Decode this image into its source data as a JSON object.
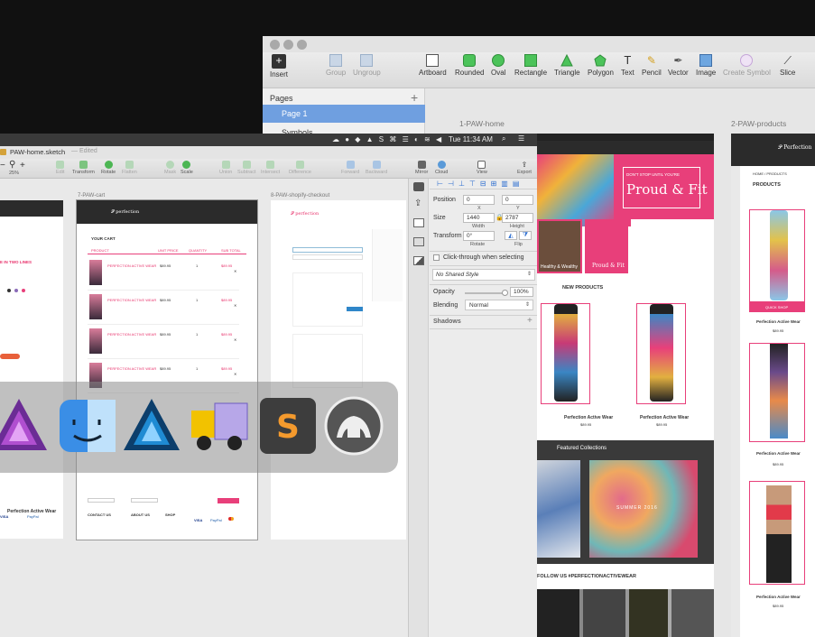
{
  "back_window": {
    "toolbar": {
      "insert": "Insert",
      "group": "Group",
      "ungroup": "Ungroup",
      "artboard": "Artboard",
      "rounded": "Rounded",
      "oval": "Oval",
      "rectangle": "Rectangle",
      "triangle": "Triangle",
      "polygon": "Polygon",
      "text": "Text",
      "pencil": "Pencil",
      "vector": "Vector",
      "image": "Image",
      "create_symbol": "Create Symbol",
      "slice": "Slice"
    },
    "pages": {
      "heading": "Pages",
      "items": [
        "Page 1",
        "Symbols"
      ]
    },
    "artboards": {
      "home_label": "1-PAW-home",
      "products_label": "2-PAW-products"
    },
    "home_artboard": {
      "hero_line1": "DON'T STOP UNTIL YOU'RE",
      "hero_title": "Proud & Fit",
      "tile_caption_1": "Healthy & Wealthy",
      "tile_caption_2": "Proud & Fit",
      "new_products": "NEW PRODUCTS",
      "product_name_1": "Perfection Active Wear",
      "product_name_2": "Perfection Active Wear",
      "product_price_1": "$89.95",
      "product_price_2": "$89.95",
      "featured": "Featured Collections",
      "summer": "SUMMER 2016",
      "follow": "FOLLOW US #PERFECTIONACTIVEWEAR"
    },
    "products_artboard": {
      "breadcrumb": "HOME / PRODUCTS",
      "heading": "PRODUCTS",
      "quick_shop": "QUICK SHOP",
      "items": [
        {
          "name": "Perfection Active Wear",
          "price": "$89.95"
        },
        {
          "name": "Perfection Active Wear",
          "price": "$89.95"
        },
        {
          "name": "Perfection Active Wear",
          "price": "$89.95"
        }
      ]
    }
  },
  "front_window": {
    "menubar": {
      "clock": "Tue 11:34 AM"
    },
    "title": "PAW-home.sketch",
    "title_status": "— Edited",
    "zoom": "25%",
    "toolbar": {
      "edit": "Edit",
      "transform": "Transform",
      "rotate": "Rotate",
      "flatten": "Flatten",
      "mask": "Mask",
      "scale": "Scale",
      "union": "Union",
      "subtract": "Subtract",
      "intersect": "Intersect",
      "difference": "Difference",
      "forward": "Forward",
      "backward": "Backward",
      "mirror": "Mirror",
      "cloud": "Cloud",
      "view": "View",
      "export": "Export"
    },
    "artboards": {
      "cart_label": "7-PAW-cart",
      "checkout_label": "8-PAW-shopify-checkout"
    },
    "cart": {
      "heading": "YOUR CART",
      "columns": [
        "PRODUCT",
        "UNIT PRICE",
        "QUANTITY",
        "SUB TOTAL"
      ],
      "rows": [
        {
          "name": "PERFECTION ACTIVE WEAR",
          "price": "$89.95",
          "qty": "1",
          "total": "$89.95"
        },
        {
          "name": "PERFECTION ACTIVE WEAR",
          "price": "$89.95",
          "qty": "1",
          "total": "$89.95"
        },
        {
          "name": "PERFECTION ACTIVE WEAR",
          "price": "$89.95",
          "qty": "1",
          "total": "$89.95"
        },
        {
          "name": "PERFECTION ACTIVE WEAR",
          "price": "$89.95",
          "qty": "1",
          "total": "$89.95"
        }
      ],
      "footer_cols": [
        "CONTACT US",
        "ABOUT US",
        "SHOP"
      ]
    },
    "left_artboard": {
      "headline": "E IN TWO LINES",
      "product": "Perfection Active Wear"
    },
    "inspector": {
      "position_label": "Position",
      "x": "0",
      "y": "0",
      "x_sub": "X",
      "y_sub": "Y",
      "size_label": "Size",
      "width": "1440",
      "height": "2787",
      "width_sub": "Width",
      "height_sub": "Height",
      "transform_label": "Transform",
      "rotate": "0°",
      "rotate_sub": "Rotate",
      "flip_sub": "Flip",
      "click_through": "Click-through when selecting",
      "shared_style": "No Shared Style",
      "opacity_label": "Opacity",
      "opacity_value": "100%",
      "opacity_level": 1.0,
      "blending_label": "Blending",
      "blending_value": "Normal",
      "shadows_label": "Shadows"
    }
  },
  "dock": {
    "apps": [
      "affinity-photo-icon",
      "finder-icon",
      "affinity-designer-icon",
      "transmit-icon",
      "sublime-text-icon",
      "sequel-pro-icon"
    ]
  }
}
